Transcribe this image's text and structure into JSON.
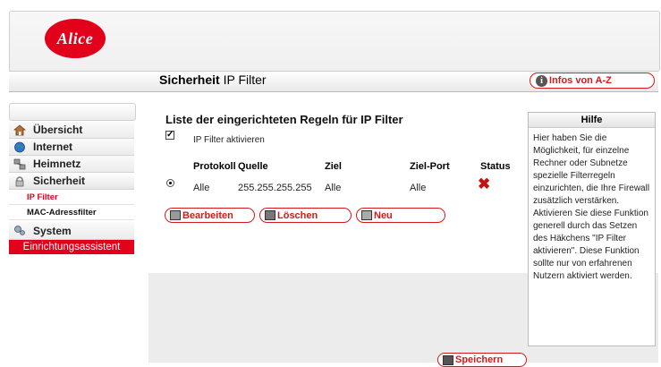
{
  "header": {
    "logo_text": "Alice",
    "title_bold": "Sicherheit",
    "title_rest": " IP Filter",
    "infos_label": "Infos von A-Z"
  },
  "sidebar": {
    "items": [
      {
        "label": "Übersicht",
        "icon": "home-icon"
      },
      {
        "label": "Internet",
        "icon": "globe-icon"
      },
      {
        "label": "Heimnetz",
        "icon": "network-icon"
      },
      {
        "label": "Sicherheit",
        "icon": "lock-icon"
      }
    ],
    "subitems": [
      {
        "label": "IP Filter",
        "active": true
      },
      {
        "label": "MAC-Adressfilter",
        "active": false
      }
    ],
    "system_label": "System",
    "assistant_label": "Einrichtungsassistent"
  },
  "main": {
    "list_title": "Liste der eingerichteten Regeln für IP Filter",
    "checkbox_label": "IP Filter aktivieren",
    "checkbox_checked": true,
    "columns": [
      "Protokoll",
      "Quelle",
      "Ziel",
      "Ziel-Port",
      "Status"
    ],
    "rows": [
      {
        "protokoll": "Alle",
        "quelle": "255.255.255.255",
        "ziel": "Alle",
        "ziel_port": "Alle",
        "status": "inactive"
      }
    ],
    "buttons": {
      "edit": "Bearbeiten",
      "delete": "Löschen",
      "new": "Neu"
    }
  },
  "help": {
    "title": "Hilfe",
    "text": "Hier haben Sie die Möglichkeit, für einzelne Rechner oder Subnetze spezielle Filterregeln einzurichten, die Ihre Firewall zusätzlich verstärken. Aktivieren Sie diese Funktion generell durch das Setzen des Häkchens \"IP Filter aktivieren\". Diese Funktion sollte nur von erfahrenen Nutzern aktiviert werden."
  },
  "footer": {
    "save_label": "Speichern"
  },
  "colors": {
    "brand_red": "#e2001a",
    "button_red": "#d31a1a"
  }
}
